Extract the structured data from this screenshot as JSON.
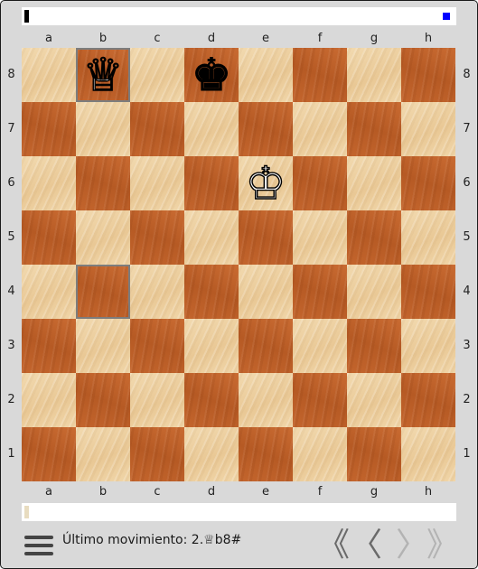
{
  "board": {
    "files": [
      "a",
      "b",
      "c",
      "d",
      "e",
      "f",
      "g",
      "h"
    ],
    "ranks": [
      "8",
      "7",
      "6",
      "5",
      "4",
      "3",
      "2",
      "1"
    ],
    "highlighted_squares": [
      "b8",
      "b4"
    ],
    "pieces": [
      {
        "square": "b8",
        "type": "queen",
        "color": "white",
        "glyph": "♕"
      },
      {
        "square": "d8",
        "type": "king",
        "color": "black",
        "glyph": "♚"
      },
      {
        "square": "e6",
        "type": "king",
        "color": "white",
        "glyph": "♔"
      }
    ],
    "colors": {
      "light_square": "#edcf9e",
      "dark_square": "#c0632b",
      "highlight_border": "#7d7d7d"
    }
  },
  "status_top": {
    "turn_marker_color": "#000000",
    "indicator_color": "#0000ff"
  },
  "status_bottom": {
    "marker_color": "#e8dcc0"
  },
  "footer": {
    "menu_icon": "hamburger-menu-icon",
    "last_move_label": "Último movimiento:",
    "last_move_value": "2.♕b8#"
  },
  "navigation": {
    "first": {
      "glyph": "《",
      "icon": "double-chevron-left-icon",
      "enabled": true
    },
    "prev": {
      "glyph": "〈",
      "icon": "chevron-left-icon",
      "enabled": true
    },
    "next": {
      "glyph": "〉",
      "icon": "chevron-right-icon",
      "enabled": false
    },
    "last": {
      "glyph": "》",
      "icon": "double-chevron-right-icon",
      "enabled": false
    }
  }
}
